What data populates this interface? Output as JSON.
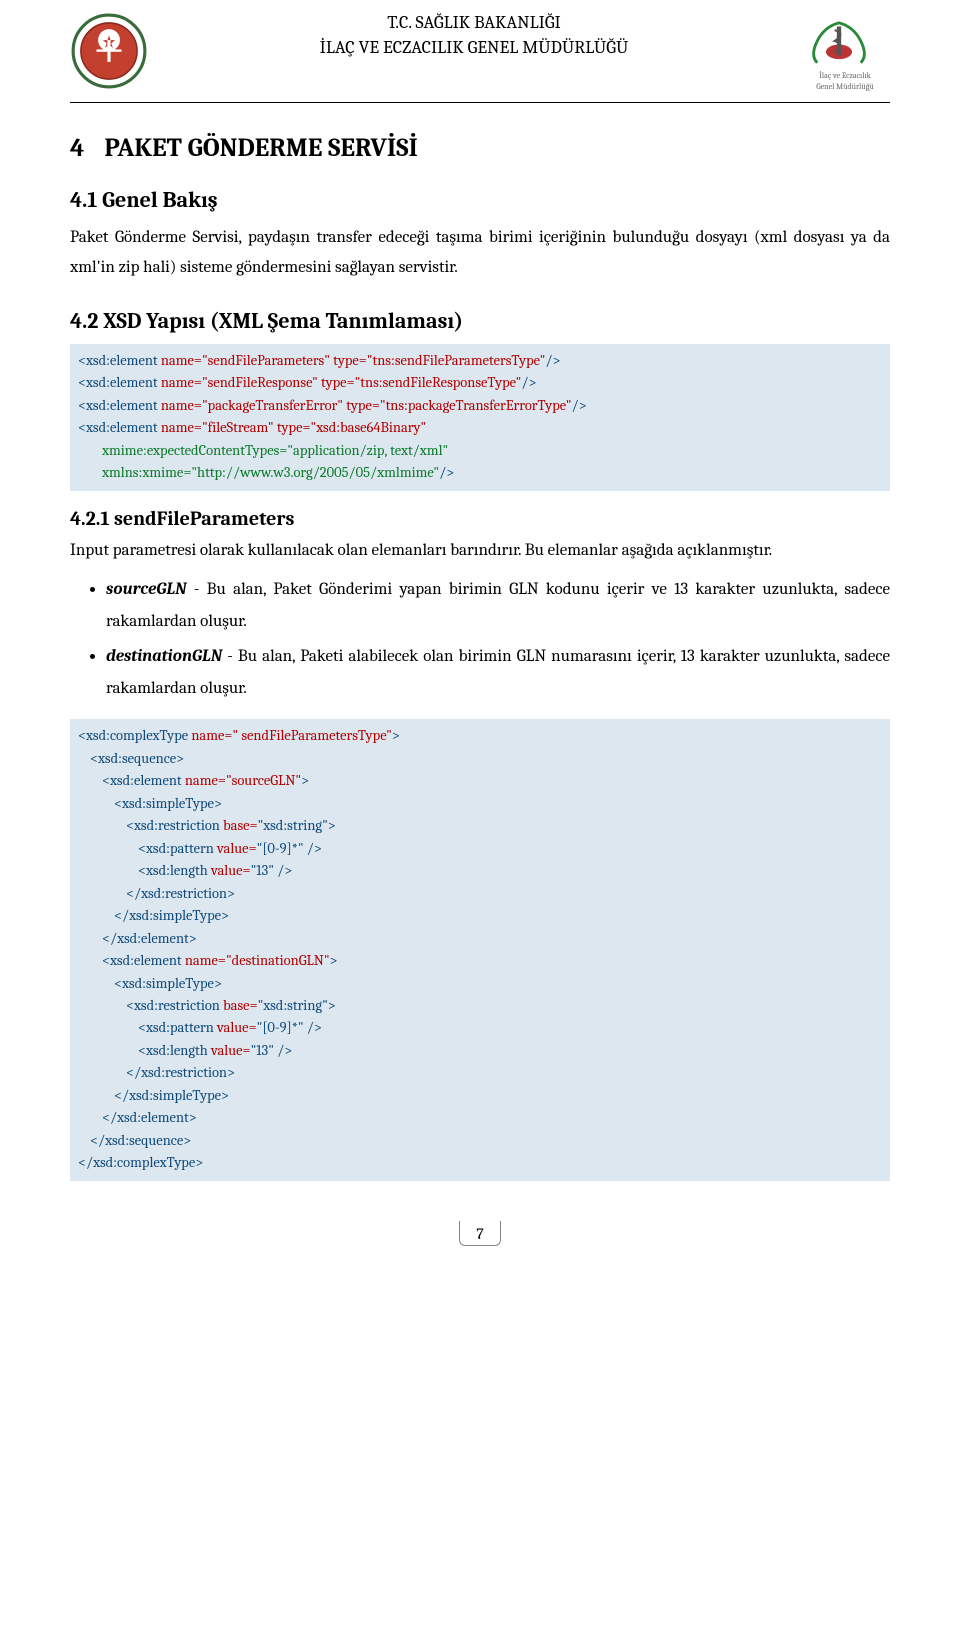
{
  "header": {
    "line1": "T.C. SAĞLIK BAKANLIĞI",
    "line2": "İLAÇ VE ECZACILIK GENEL MÜDÜRLÜĞÜ",
    "right_logo_caption1": "İlaç ve Eczacılık",
    "right_logo_caption2": "Genel Müdürlüğü"
  },
  "section": {
    "num": "4",
    "title": "PAKET GÖNDERME SERVİSİ"
  },
  "sub41": {
    "heading": "4.1   Genel Bakış",
    "para": "Paket Gönderme Servisi, paydaşın transfer edeceği taşıma birimi içeriğinin bulunduğu dosyayı (xml dosyası ya da xml'in zip hali) sisteme göndermesini sağlayan servistir."
  },
  "sub42": {
    "heading": "4.2   XSD Yapısı (XML Şema Tanımlaması)"
  },
  "code1": {
    "l1a": "<xsd:element ",
    "l1b": "name=\"sendFileParameters\" ",
    "l1c": "type=\"tns:sendFileParametersType\"",
    "l1d": "/>",
    "l2a": "<xsd:element ",
    "l2b": "name=\"sendFileResponse\" ",
    "l2c": "type=\"tns:sendFileResponseType\"",
    "l2d": "/>",
    "l3a": "<xsd:element ",
    "l3b": "name=\"packageTransferError\" ",
    "l3c": "type=\"tns:packageTransferErrorType\"",
    "l3d": "/>",
    "l4a": "<xsd:element ",
    "l4b": "name=\"fileStream\" ",
    "l4c": "type=\"xsd:base64Binary\"",
    "l5a": "xmime:expectedContentTypes=\"application/zip, text/xml\"",
    "l6a": "xmlns:xmime=\"http://www.w3.org/2005/05/xmlmime\"",
    "l6b": "/>"
  },
  "sub421": {
    "heading": "4.2.1   sendFileParameters",
    "para": "Input parametresi olarak kullanılacak olan elemanları barındırır. Bu elemanlar aşağıda açıklanmıştır."
  },
  "bullets": {
    "b1_kw": "sourceGLN",
    "b1_txt": " - Bu alan, Paket Gönderimi yapan birimin GLN kodunu içerir ve 13 karakter uzunlukta, sadece rakamlardan oluşur.",
    "b2_kw": "destinationGLN",
    "b2_txt": " - Bu alan, Paketi alabilecek olan birimin GLN numarasını içerir, 13 karakter uzunlukta, sadece rakamlardan oluşur."
  },
  "code2": {
    "l1a": "<xsd:complexType ",
    "l1b": "name=\" sendFileParametersType\"",
    "l1c": ">",
    "l2": "<xsd:sequence>",
    "l3a": "<xsd:element ",
    "l3b": "name=\"sourceGLN\"",
    "l3c": ">",
    "l4": "<xsd:simpleType>",
    "l5a": "<xsd:restriction ",
    "l5b": "base=",
    "l5c": "\"xsd:string\"",
    "l5d": ">",
    "l6a": "<xsd:pattern ",
    "l6b": "value=",
    "l6c": "\"[0-9]*\"",
    "l6d": " />",
    "l7a": "<xsd:length ",
    "l7b": "value=",
    "l7c": "\"13\"",
    "l7d": " />",
    "l8": "</xsd:restriction>",
    "l9": "</xsd:simpleType>",
    "l10": "</xsd:element>",
    "l11a": "<xsd:element ",
    "l11b": "name=\"destinationGLN\"",
    "l11c": ">",
    "l12": "<xsd:simpleType>",
    "l13a": "<xsd:restriction ",
    "l13b": "base=",
    "l13c": "\"xsd:string\"",
    "l13d": ">",
    "l14a": "<xsd:pattern ",
    "l14b": "value=",
    "l14c": "\"[0-9]*\"",
    "l14d": " />",
    "l15a": "<xsd:length ",
    "l15b": "value=",
    "l15c": "\"13\"",
    "l15d": " />",
    "l16": "</xsd:restriction>",
    "l17": "</xsd:simpleType>",
    "l18": "</xsd:element>",
    "l19": "</xsd:sequence>",
    "l20": "</xsd:complexType>"
  },
  "footer": {
    "page": "7"
  }
}
